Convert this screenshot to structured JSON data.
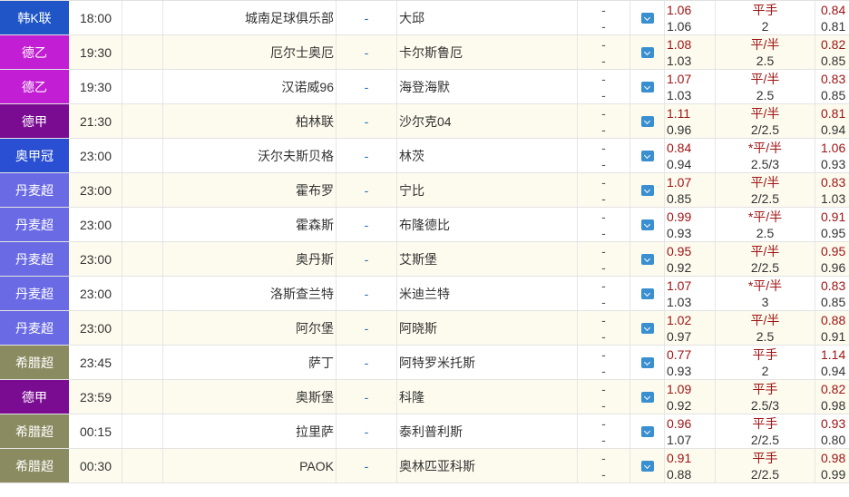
{
  "leagues": {
    "韩K联": "#1f55c7",
    "德乙": "#c21fd4",
    "德甲": "#7a0c92",
    "奥甲冠": "#2a4fd2",
    "丹麦超": "#6a6be4",
    "希腊超": "#8b8b62"
  },
  "rows": [
    {
      "league": "韩K联",
      "time": "18:00",
      "home": "城南足球俱乐部",
      "dash": "-",
      "away": "大邱",
      "ou_top": "-",
      "ou_bot": "-",
      "h_top": "1.06",
      "h_bot": "1.06",
      "line_top": "平手",
      "line_bot": "2",
      "a_top": "0.84",
      "a_bot": "0.81"
    },
    {
      "league": "德乙",
      "time": "19:30",
      "home": "厄尔士奥厄",
      "dash": "-",
      "away": "卡尔斯鲁厄",
      "ou_top": "-",
      "ou_bot": "-",
      "h_top": "1.08",
      "h_bot": "1.03",
      "line_top": "平/半",
      "line_bot": "2.5",
      "a_top": "0.82",
      "a_bot": "0.85"
    },
    {
      "league": "德乙",
      "time": "19:30",
      "home": "汉诺威96",
      "dash": "-",
      "away": "海登海默",
      "ou_top": "-",
      "ou_bot": "-",
      "h_top": "1.07",
      "h_bot": "1.03",
      "line_top": "平/半",
      "line_bot": "2.5",
      "a_top": "0.83",
      "a_bot": "0.85"
    },
    {
      "league": "德甲",
      "time": "21:30",
      "home": "柏林联",
      "dash": "-",
      "away": "沙尔克04",
      "ou_top": "-",
      "ou_bot": "-",
      "h_top": "1.11",
      "h_bot": "0.96",
      "line_top": "平/半",
      "line_bot": "2/2.5",
      "a_top": "0.81",
      "a_bot": "0.94"
    },
    {
      "league": "奥甲冠",
      "time": "23:00",
      "home": "沃尔夫斯贝格",
      "dash": "-",
      "away": "林茨",
      "ou_top": "-",
      "ou_bot": "-",
      "h_top": "0.84",
      "h_bot": "0.94",
      "line_top": "*平/半",
      "line_bot": "2.5/3",
      "a_top": "1.06",
      "a_bot": "0.93"
    },
    {
      "league": "丹麦超",
      "time": "23:00",
      "home": "霍布罗",
      "dash": "-",
      "away": "宁比",
      "ou_top": "-",
      "ou_bot": "-",
      "h_top": "1.07",
      "h_bot": "0.85",
      "line_top": "平/半",
      "line_bot": "2/2.5",
      "a_top": "0.83",
      "a_bot": "1.03"
    },
    {
      "league": "丹麦超",
      "time": "23:00",
      "home": "霍森斯",
      "dash": "-",
      "away": "布隆德比",
      "ou_top": "-",
      "ou_bot": "-",
      "h_top": "0.99",
      "h_bot": "0.93",
      "line_top": "*平/半",
      "line_bot": "2.5",
      "a_top": "0.91",
      "a_bot": "0.95"
    },
    {
      "league": "丹麦超",
      "time": "23:00",
      "home": "奥丹斯",
      "dash": "-",
      "away": "艾斯堡",
      "ou_top": "-",
      "ou_bot": "-",
      "h_top": "0.95",
      "h_bot": "0.92",
      "line_top": "平/半",
      "line_bot": "2/2.5",
      "a_top": "0.95",
      "a_bot": "0.96"
    },
    {
      "league": "丹麦超",
      "time": "23:00",
      "home": "洛斯查兰特",
      "dash": "-",
      "away": "米迪兰特",
      "ou_top": "-",
      "ou_bot": "-",
      "h_top": "1.07",
      "h_bot": "1.03",
      "line_top": "*平/半",
      "line_bot": "3",
      "a_top": "0.83",
      "a_bot": "0.85"
    },
    {
      "league": "丹麦超",
      "time": "23:00",
      "home": "阿尔堡",
      "dash": "-",
      "away": "阿晓斯",
      "ou_top": "-",
      "ou_bot": "-",
      "h_top": "1.02",
      "h_bot": "0.97",
      "line_top": "平/半",
      "line_bot": "2.5",
      "a_top": "0.88",
      "a_bot": "0.91"
    },
    {
      "league": "希腊超",
      "time": "23:45",
      "home": "萨丁",
      "dash": "-",
      "away": "阿特罗米托斯",
      "ou_top": "-",
      "ou_bot": "-",
      "h_top": "0.77",
      "h_bot": "0.93",
      "line_top": "平手",
      "line_bot": "2",
      "a_top": "1.14",
      "a_bot": "0.94"
    },
    {
      "league": "德甲",
      "time": "23:59",
      "home": "奥斯堡",
      "dash": "-",
      "away": "科隆",
      "ou_top": "-",
      "ou_bot": "-",
      "h_top": "1.09",
      "h_bot": "0.92",
      "line_top": "平手",
      "line_bot": "2.5/3",
      "a_top": "0.82",
      "a_bot": "0.98"
    },
    {
      "league": "希腊超",
      "time": "00:15",
      "home": "拉里萨",
      "dash": "-",
      "away": "泰利普利斯",
      "ou_top": "-",
      "ou_bot": "-",
      "h_top": "0.96",
      "h_bot": "1.07",
      "line_top": "平手",
      "line_bot": "2/2.5",
      "a_top": "0.93",
      "a_bot": "0.80"
    },
    {
      "league": "希腊超",
      "time": "00:30",
      "home": "PAOK",
      "dash": "-",
      "away": "奥林匹亚科斯",
      "ou_top": "-",
      "ou_bot": "-",
      "h_top": "0.91",
      "h_bot": "0.88",
      "line_top": "平手",
      "line_bot": "2/2.5",
      "a_top": "0.98",
      "a_bot": "0.99"
    }
  ]
}
